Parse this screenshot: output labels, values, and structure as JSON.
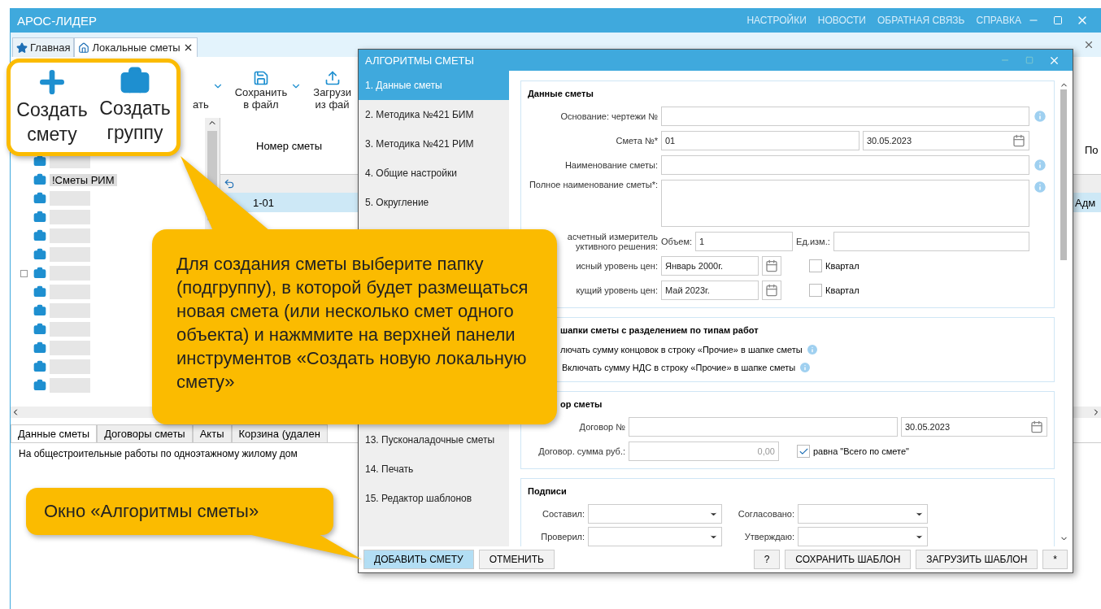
{
  "app": {
    "title": "АРОС-ЛИДЕР",
    "menu": [
      "НАСТРОЙКИ",
      "НОВОСТИ",
      "ОБРАТНАЯ СВЯЗЬ",
      "СПРАВКА"
    ]
  },
  "tabs": [
    {
      "label": "Главная",
      "kind": "star",
      "selected": false
    },
    {
      "label": "Локальные сметы",
      "kind": "home",
      "selected": true
    }
  ],
  "toolbar": [
    {
      "lines": [
        "ать"
      ],
      "kind": "cut",
      "dropdown": true
    },
    {
      "lines": [
        "Сохранить",
        "в файл"
      ],
      "kind": "save",
      "dropdown": true
    },
    {
      "lines": [
        "Загрузи",
        "из фай"
      ],
      "kind": "load",
      "dropdown": false
    }
  ],
  "tree": {
    "items": [
      {
        "kind": "blurred",
        "collapsed": false,
        "selected": false
      },
      {
        "kind": "label",
        "label": "!Сметы РИМ",
        "collapsed": false,
        "selected": true
      },
      {
        "kind": "blurred",
        "collapsed": false,
        "selected": false
      },
      {
        "kind": "blurred",
        "collapsed": false,
        "selected": false
      },
      {
        "kind": "blurred",
        "collapsed": false,
        "selected": false
      },
      {
        "kind": "blurred",
        "collapsed": false,
        "selected": false
      },
      {
        "kind": "blurred",
        "collapsed": true,
        "selected": false
      },
      {
        "kind": "blurred",
        "collapsed": false,
        "selected": false
      },
      {
        "kind": "blurred",
        "collapsed": false,
        "selected": false
      },
      {
        "kind": "blurred",
        "collapsed": false,
        "selected": false
      },
      {
        "kind": "blurred",
        "collapsed": false,
        "selected": false
      },
      {
        "kind": "blurred",
        "collapsed": false,
        "selected": false
      },
      {
        "kind": "blurred",
        "collapsed": false,
        "selected": false
      }
    ]
  },
  "table": {
    "columns": [
      "Номер сметы"
    ],
    "rows": [
      {
        "cells": [
          "1-01"
        ],
        "selected": true
      }
    ]
  },
  "right_strip": {
    "column": "По",
    "cell": "Адм"
  },
  "bottom_tabs": [
    {
      "label": "Данные сметы",
      "selected": true
    },
    {
      "label": "Договоры сметы",
      "selected": false
    },
    {
      "label": "Акты",
      "selected": false
    },
    {
      "label": "Корзина (удален",
      "selected": false
    }
  ],
  "description": "На общестроительные работы по одноэтажному жилому дом",
  "dialog": {
    "title": "АЛГОРИТМЫ СМЕТЫ",
    "menu_sections": [
      {
        "items": [
          {
            "label": "1. Данные сметы",
            "selected": true
          },
          {
            "label": "2. Методика №421 БИМ",
            "selected": false
          },
          {
            "label": "3. Методика №421 РИМ",
            "selected": false
          },
          {
            "label": "4. Общие настройки",
            "selected": false
          },
          {
            "label": "5. Округление",
            "selected": false
          }
        ]
      },
      {
        "items": [
          {
            "label": "13. Пусконаладочные сметы",
            "selected": false
          },
          {
            "label": "14. Печать",
            "selected": false
          },
          {
            "label": "15. Редактор шаблонов",
            "selected": false
          }
        ]
      }
    ],
    "estimate": {
      "title": "Данные сметы",
      "basis_label": "Основание: чертежи №",
      "number_label": "Смета №*",
      "number": "01",
      "date": "30.05.2023",
      "name_label": "Наименование сметы:",
      "full_name_label": "Полное наименование сметы*:",
      "meter_label": [
        "асчетный измеритель",
        "уктивного решения:"
      ],
      "volume_label": "Объем:",
      "volume": "1",
      "unit_label": "Ед.изм.:",
      "price_levels": [
        {
          "label": "исный уровень цен:",
          "value": "Январь 2000г.",
          "quarter_label": "Квартал",
          "checked": false
        },
        {
          "label": "кущий уровень цен:",
          "value": "Май 2023г.",
          "quarter_label": "Квартал",
          "checked": false
        }
      ]
    },
    "header": {
      "title": "шапки сметы с разделением по типам работ",
      "options": [
        "лючать сумму концовок в строку «Прочие» в шапке сметы",
        "Включать сумму НДС в строку «Прочие» в шапке сметы"
      ]
    },
    "contract": {
      "title": "ор сметы",
      "number_label": "Договор №",
      "date": "30.05.2023",
      "sum_label": "Договор. сумма руб.:",
      "sum": "0,00",
      "equal_label": "равна \"Всего по смете\"",
      "equal_checked": true
    },
    "signatures": {
      "title": "Подписи",
      "fields": [
        "Составил:",
        "Согласовано:",
        "Проверил:",
        "Утверждаю:"
      ]
    },
    "buttons": [
      {
        "label": "ДОБАВИТЬ СМЕТУ",
        "kind": "primary"
      },
      {
        "label": "ОТМЕНИТЬ",
        "kind": "normal"
      },
      {
        "label": "?",
        "kind": "right"
      },
      {
        "label": "СОХРАНИТЬ ШАБЛОН",
        "kind": "normal"
      },
      {
        "label": "ЗАГРУЗИТЬ ШАБЛОН",
        "kind": "normal"
      },
      {
        "label": "*",
        "kind": "normal"
      }
    ]
  },
  "callouts": {
    "highlight": [
      {
        "lines": [
          "Создать",
          "смету"
        ],
        "kind": "plus"
      },
      {
        "lines": [
          "Создать",
          "группу"
        ],
        "kind": "folder"
      }
    ],
    "main": "Для создания сметы выберите папку (подгруппу), в которой будет размещаться новая смета (или несколько смет одного объекта) и нажммите на верхней панели инструментов «Создать новую локальную смету»",
    "window": "Окно «Алгоритмы сметы»"
  }
}
